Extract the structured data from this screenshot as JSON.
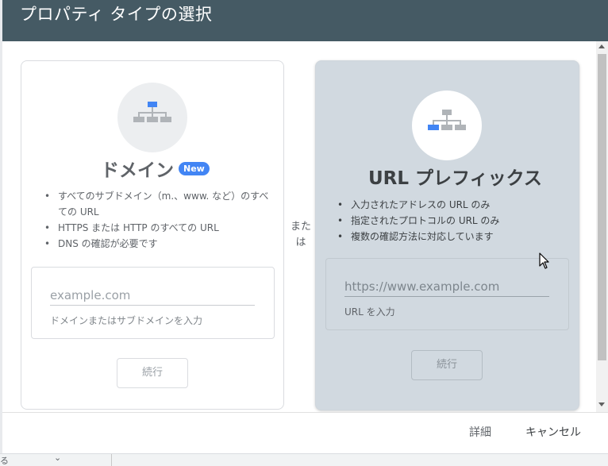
{
  "dialog": {
    "title": "プロパティ タイプの選択"
  },
  "domain_card": {
    "title": "ドメイン",
    "badge": "New",
    "bullets": [
      "すべてのサブドメイン（m.、www. など）のすべての URL",
      "HTTPS または HTTP のすべての URL",
      "DNS の確認が必要です"
    ],
    "input_placeholder": "example.com",
    "input_value": "",
    "input_help": "ドメインまたはサブドメインを入力",
    "continue_label": "続行"
  },
  "or_label": "または",
  "url_card": {
    "title": "URL プレフィックス",
    "bullets": [
      "入力されたアドレスの URL のみ",
      "指定されたプロトコルの URL のみ",
      "複数の確認方法に対応しています"
    ],
    "input_placeholder": "https://www.example.com",
    "input_value": "",
    "input_help": "URL を入力",
    "continue_label": "続行"
  },
  "footer": {
    "details_label": "詳細",
    "cancel_label": "キャンセル"
  },
  "background": {
    "partial_text": "る"
  },
  "colors": {
    "header": "#455a64",
    "badge": "#4285f4",
    "selected_card": "#d1d9e0",
    "icon_active": "#4285f4",
    "icon_inactive": "#b0b4b8"
  },
  "icons": {
    "domain": "sitemap-icon-top-highlighted",
    "url_prefix": "sitemap-icon-left-leaf-highlighted"
  }
}
